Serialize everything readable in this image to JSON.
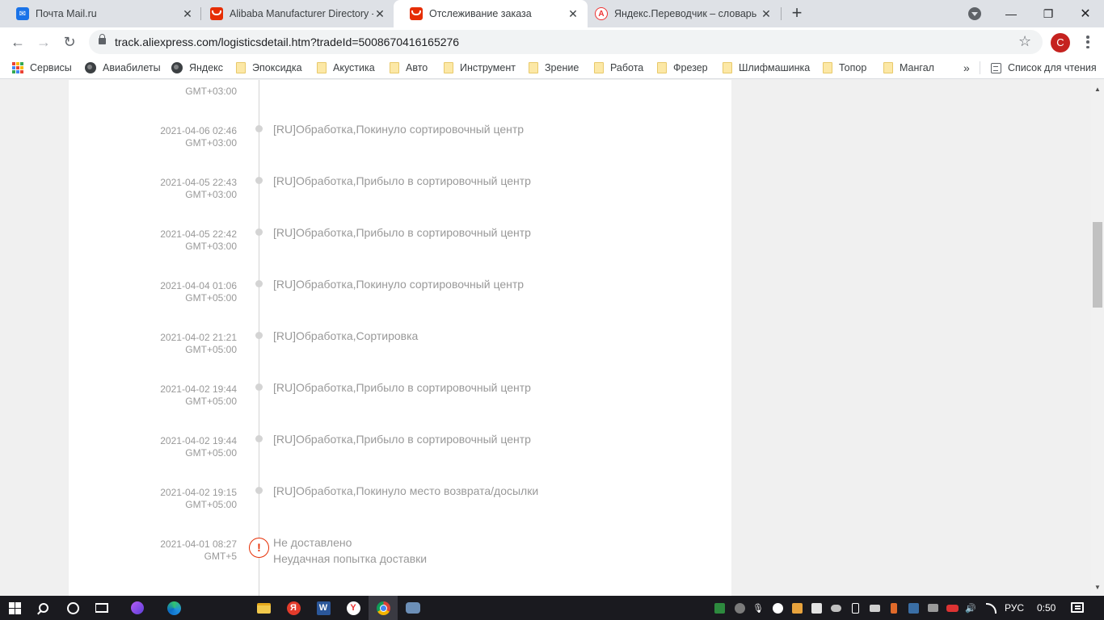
{
  "tabs": [
    {
      "title": "Почта Mail.ru",
      "icon": "mail-icon"
    },
    {
      "title": "Alibaba Manufacturer Directory -",
      "icon": "alibaba-icon"
    },
    {
      "title": "Отслеживание заказа",
      "icon": "aliexpress-icon",
      "active": true
    },
    {
      "title": "Яндекс.Переводчик – словарь и",
      "icon": "yandex-translate-icon"
    }
  ],
  "toolbar": {
    "url": "track.aliexpress.com/logisticsdetail.htm?tradeId=5008670416165276",
    "profile_initial": "C"
  },
  "bookmarks": [
    {
      "label": "Сервисы",
      "icon": "apps-grid-icon"
    },
    {
      "label": "Авиабилеты",
      "icon": "globe-icon"
    },
    {
      "label": "Яндекс",
      "icon": "globe-icon"
    },
    {
      "label": "Эпоксидка",
      "icon": "folder-icon"
    },
    {
      "label": "Акустика",
      "icon": "folder-icon"
    },
    {
      "label": "Авто",
      "icon": "folder-icon"
    },
    {
      "label": "Инструмент",
      "icon": "folder-icon"
    },
    {
      "label": "Зрение",
      "icon": "folder-icon"
    },
    {
      "label": "Работа",
      "icon": "folder-icon"
    },
    {
      "label": "Фрезер",
      "icon": "folder-icon"
    },
    {
      "label": "Шлифмашинка",
      "icon": "folder-icon"
    },
    {
      "label": "Топор",
      "icon": "folder-icon"
    },
    {
      "label": "Мангал",
      "icon": "folder-icon"
    }
  ],
  "reading_list_label": "Список для чтения",
  "tracking": {
    "top_partial": {
      "tz": "GMT+03:00"
    },
    "events": [
      {
        "date": "2021-04-06 02:46",
        "tz": "GMT+03:00",
        "desc": "[RU]Обработка,Покинуло сортировочный центр"
      },
      {
        "date": "2021-04-05 22:43",
        "tz": "GMT+03:00",
        "desc": "[RU]Обработка,Прибыло в сортировочный центр"
      },
      {
        "date": "2021-04-05 22:42",
        "tz": "GMT+03:00",
        "desc": "[RU]Обработка,Прибыло в сортировочный центр"
      },
      {
        "date": "2021-04-04 01:06",
        "tz": "GMT+05:00",
        "desc": "[RU]Обработка,Покинуло сортировочный центр"
      },
      {
        "date": "2021-04-02 21:21",
        "tz": "GMT+05:00",
        "desc": "[RU]Обработка,Сортировка"
      },
      {
        "date": "2021-04-02 19:44",
        "tz": "GMT+05:00",
        "desc": "[RU]Обработка,Прибыло в сортировочный центр"
      },
      {
        "date": "2021-04-02 19:44",
        "tz": "GMT+05:00",
        "desc": "[RU]Обработка,Прибыло в сортировочный центр"
      },
      {
        "date": "2021-04-02 19:15",
        "tz": "GMT+05:00",
        "desc": "[RU]Обработка,Покинуло место возврата/досылки"
      }
    ],
    "alert_event": {
      "date": "2021-04-01 08:27",
      "tz": "GMT+5",
      "status": "Не доставлено",
      "detail": "Неудачная попытка доставки",
      "icon_glyph": "!"
    }
  },
  "taskbar": {
    "apps": [
      "windows-start-icon",
      "search-icon",
      "cortana-icon",
      "task-view-icon",
      "alice-icon",
      "edge-icon",
      "file-explorer-icon",
      "yandex-icon",
      "word-icon",
      "yandex-browser-icon",
      "chrome-icon",
      "game-icon"
    ],
    "language": "РУС",
    "clock": "0:50"
  },
  "colors": {
    "aliexpress_red": "#e62e04",
    "timeline_text": "#999999",
    "timeline_line": "#d4d4d4"
  }
}
